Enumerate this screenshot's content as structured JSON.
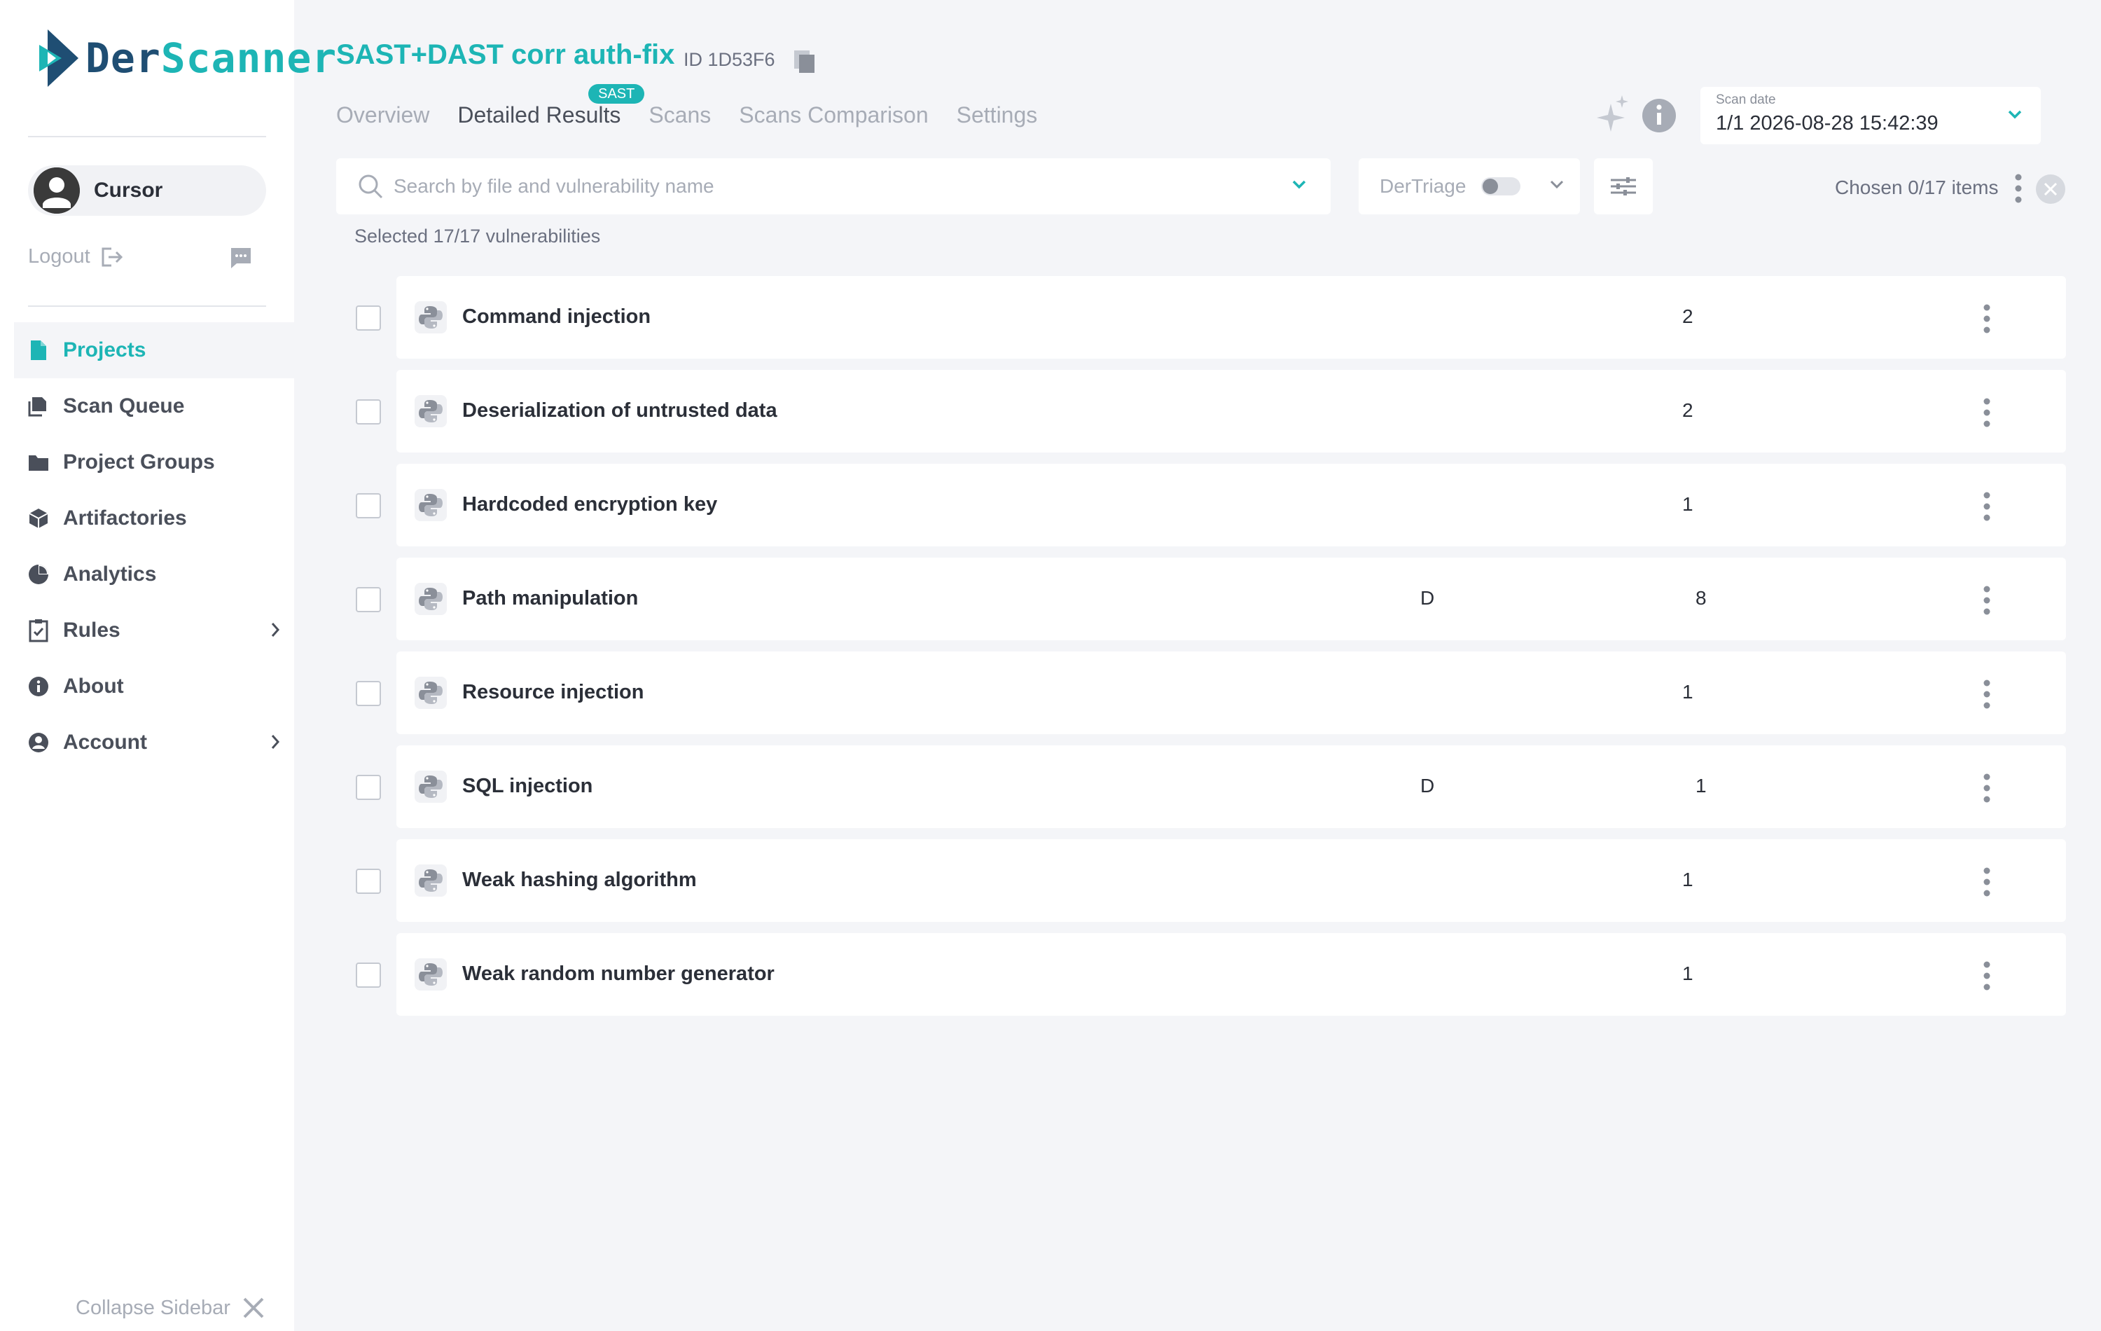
{
  "brand": {
    "part1": "Der",
    "part2": "Scanner",
    "accent": "#1db5b5",
    "dark": "#1f4e73"
  },
  "user": {
    "name": "Cursor"
  },
  "sidebar": {
    "logout_label": "Logout",
    "collapse_label": "Collapse Sidebar",
    "items": [
      {
        "label": "Projects",
        "icon": "file-icon",
        "active": true
      },
      {
        "label": "Scan Queue",
        "icon": "queue-icon"
      },
      {
        "label": "Project Groups",
        "icon": "folder-icon"
      },
      {
        "label": "Artifactories",
        "icon": "box-icon"
      },
      {
        "label": "Analytics",
        "icon": "pie-chart-icon"
      },
      {
        "label": "Rules",
        "icon": "clipboard-check-icon",
        "has_submenu": true
      },
      {
        "label": "About",
        "icon": "info-icon"
      },
      {
        "label": "Account",
        "icon": "user-circle-icon",
        "has_submenu": true
      }
    ]
  },
  "header": {
    "project_title": "SAST+DAST corr auth-fix",
    "project_id": "ID 1D53F6",
    "tabs": [
      {
        "label": "Overview"
      },
      {
        "label": "Detailed Results",
        "badge": "SAST",
        "active": true
      },
      {
        "label": "Scans"
      },
      {
        "label": "Scans Comparison"
      },
      {
        "label": "Settings"
      }
    ],
    "scan_date": {
      "label": "Scan date",
      "value": "1/1 2026-08-28 15:42:39"
    }
  },
  "toolbar": {
    "search_placeholder": "Search by file and vulnerability name",
    "triage_label": "DerTriage",
    "chosen_label": "Chosen 0/17 items",
    "selected_label": "Selected 17/17 vulnerabilities"
  },
  "vulnerabilities": [
    {
      "name": "Command injection",
      "flag": "",
      "count": "2"
    },
    {
      "name": "Deserialization of untrusted data",
      "flag": "",
      "count": "2"
    },
    {
      "name": "Hardcoded encryption key",
      "flag": "",
      "count": "1"
    },
    {
      "name": "Path manipulation",
      "flag": "D",
      "count": "8"
    },
    {
      "name": "Resource injection",
      "flag": "",
      "count": "1"
    },
    {
      "name": "SQL injection",
      "flag": "D",
      "count": "1"
    },
    {
      "name": "Weak hashing algorithm",
      "flag": "",
      "count": "1"
    },
    {
      "name": "Weak random number generator",
      "flag": "",
      "count": "1"
    }
  ]
}
